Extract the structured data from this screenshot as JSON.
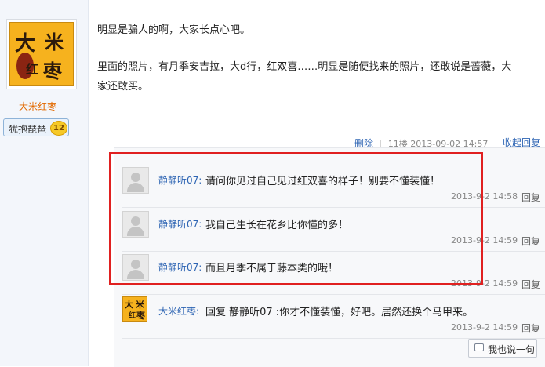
{
  "author": {
    "name": "大米红枣",
    "logo_chars": [
      "大",
      "米",
      "红",
      "枣"
    ],
    "badge_title": "犹抱琵琶",
    "badge_level": "12"
  },
  "post": {
    "line1": "明显是骗人的啊，大家长点心吧。",
    "line2": "里面的照片，有月季安吉拉，大d行，红双喜……明显是随便找来的照片，还敢说是蔷薇，大",
    "line3": "家还敢买。",
    "delete_label": "删除",
    "floor": "11楼",
    "timestamp": "2013-09-02 14:57",
    "collapse_label": "收起回复"
  },
  "replies": [
    {
      "user": "静静听07:",
      "text": "请问你见过自己见过红双喜的样子！别要不懂装懂！",
      "time": "2013-9-2 14:58",
      "reply_label": "回复"
    },
    {
      "user": "静静听07:",
      "text": "我自己生长在花乡比你懂的多！",
      "time": "2013-9-2 14:59",
      "reply_label": "回复"
    },
    {
      "user": "静静听07:",
      "text": "而且月季不属于藤本类的哦！",
      "time": "2013-9-2 14:59",
      "reply_label": "回复"
    },
    {
      "user": "大米红枣:",
      "text": "回复 静静听07 :你才不懂装懂，好吧。居然还换个马甲来。",
      "time": "2013-9-2 14:59",
      "reply_label": "回复"
    }
  ],
  "say_button_label": "我也说一句",
  "colors": {
    "highlight_frame": "#e02020",
    "link": "#2d64b3",
    "author_name": "#e36a00",
    "logo_bg": "#f6b21e"
  },
  "icons": {
    "default_avatar": "person-silhouette-icon",
    "say": "speech-bubble-icon"
  }
}
